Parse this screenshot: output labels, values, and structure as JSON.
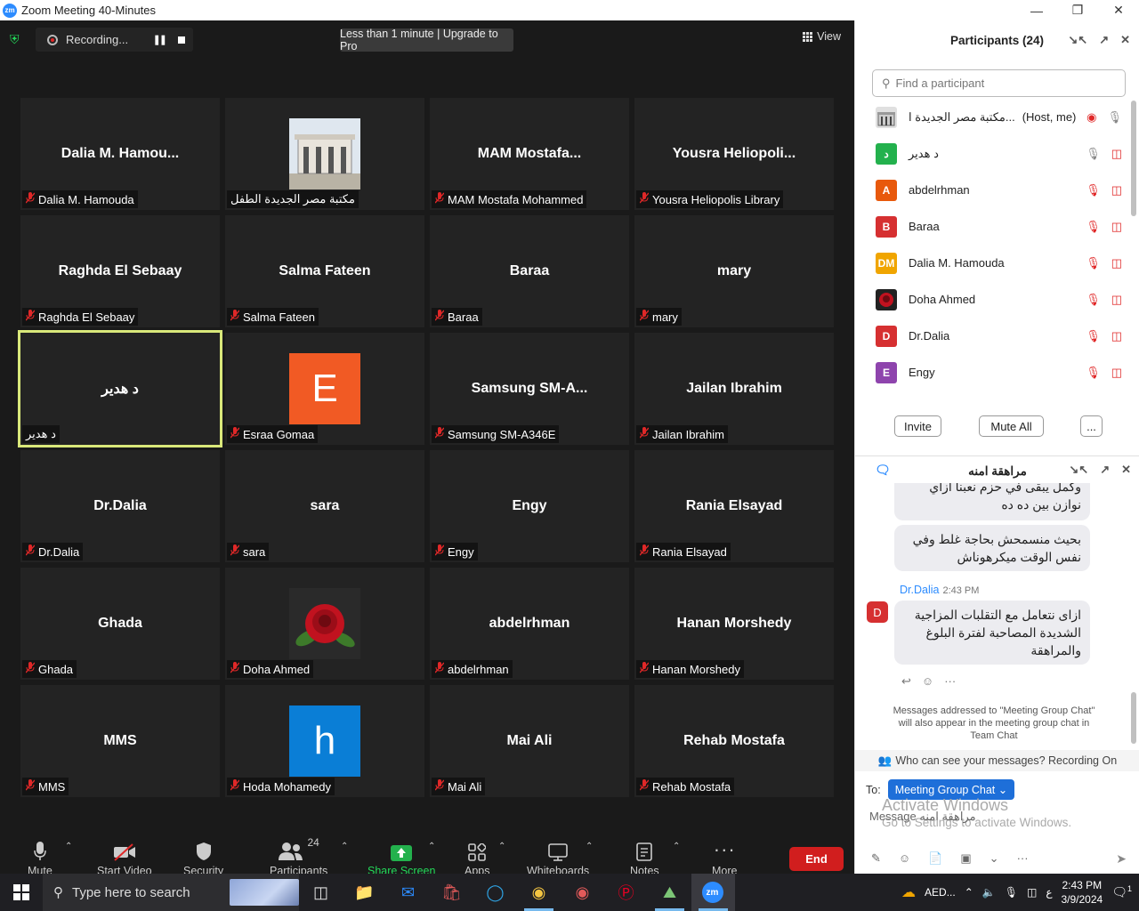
{
  "window": {
    "title": "Zoom Meeting 40-Minutes",
    "logo": "zm"
  },
  "topbar": {
    "recording_label": "Recording...",
    "timer_text": "Less than 1 minute | Upgrade to Pro",
    "view_label": "View"
  },
  "tiles": [
    {
      "display": "Dalia  M.  Hamou...",
      "label": "Dalia M. Hamouda",
      "muted": true,
      "avatar": null
    },
    {
      "display": "",
      "label": "مكتبة مصر الجديدة الطفل",
      "muted": false,
      "avatar": {
        "kind": "photo-building"
      }
    },
    {
      "display": "MAM  Mostafa...",
      "label": "MAM Mostafa Mohammed",
      "muted": true,
      "avatar": null
    },
    {
      "display": "Yousra  Heliopoli...",
      "label": "Yousra Heliopolis Library",
      "muted": true,
      "avatar": null
    },
    {
      "display": "Raghda El Sebaay",
      "label": "Raghda El Sebaay",
      "muted": true,
      "avatar": null
    },
    {
      "display": "Salma Fateen",
      "label": "Salma Fateen",
      "muted": true,
      "avatar": null
    },
    {
      "display": "Baraa",
      "label": "Baraa",
      "muted": true,
      "avatar": null
    },
    {
      "display": "mary",
      "label": "mary",
      "muted": true,
      "avatar": null
    },
    {
      "display": "د هدير",
      "label": "د هدير",
      "muted": false,
      "avatar": null,
      "active": true
    },
    {
      "display": "",
      "label": "Esraa Gomaa",
      "muted": true,
      "avatar": {
        "kind": "letter",
        "letter": "E",
        "color": "#f15a24"
      }
    },
    {
      "display": "Samsung  SM-A...",
      "label": "Samsung SM-A346E",
      "muted": true,
      "avatar": null
    },
    {
      "display": "Jailan Ibrahim",
      "label": "Jailan Ibrahim",
      "muted": true,
      "avatar": null
    },
    {
      "display": "Dr.Dalia",
      "label": "Dr.Dalia",
      "muted": true,
      "avatar": null
    },
    {
      "display": "sara",
      "label": "sara",
      "muted": true,
      "avatar": null
    },
    {
      "display": "Engy",
      "label": "Engy",
      "muted": true,
      "avatar": null
    },
    {
      "display": "Rania Elsayad",
      "label": "Rania Elsayad",
      "muted": true,
      "avatar": null
    },
    {
      "display": "Ghada",
      "label": "Ghada",
      "muted": true,
      "avatar": null
    },
    {
      "display": "",
      "label": "Doha Ahmed",
      "muted": true,
      "avatar": {
        "kind": "photo-rose"
      }
    },
    {
      "display": "abdelrhman",
      "label": "abdelrhman",
      "muted": true,
      "avatar": null
    },
    {
      "display": "Hanan Morshedy",
      "label": "Hanan Morshedy",
      "muted": true,
      "avatar": null
    },
    {
      "display": "MMS",
      "label": "MMS",
      "muted": true,
      "avatar": null
    },
    {
      "display": "",
      "label": "Hoda Mohamedy",
      "muted": true,
      "avatar": {
        "kind": "letter",
        "letter": "h",
        "color": "#0a7ed6"
      }
    },
    {
      "display": "Mai Ali",
      "label": "Mai Ali",
      "muted": true,
      "avatar": null
    },
    {
      "display": "Rehab Mostafa",
      "label": "Rehab Mostafa",
      "muted": true,
      "avatar": null
    }
  ],
  "toolbar": {
    "mute": "Mute",
    "start_video": "Start Video",
    "security": "Security",
    "participants": "Participants",
    "participants_count": "24",
    "share_screen": "Share Screen",
    "apps": "Apps",
    "whiteboards": "Whiteboards",
    "notes": "Notes",
    "more": "More",
    "end": "End"
  },
  "participants_panel": {
    "title": "Participants (24)",
    "search_placeholder": "Find a participant",
    "list": [
      {
        "name": "مكتبة مصر الجديدة ا...",
        "tag": "(Host, me)",
        "avatar": "building",
        "color": "#888"
      },
      {
        "name": "د هدير",
        "tag": "",
        "avatar": "د",
        "color": "#23b14d"
      },
      {
        "name": "abdelrhman",
        "tag": "",
        "avatar": "A",
        "color": "#e8590c"
      },
      {
        "name": "Baraa",
        "tag": "",
        "avatar": "B",
        "color": "#d63031"
      },
      {
        "name": "Dalia M. Hamouda",
        "tag": "",
        "avatar": "DM",
        "color": "#f0a500"
      },
      {
        "name": "Doha Ahmed",
        "tag": "",
        "avatar": "rose",
        "color": "#8b0000"
      },
      {
        "name": "Dr.Dalia",
        "tag": "",
        "avatar": "D",
        "color": "#d63031"
      },
      {
        "name": "Engy",
        "tag": "",
        "avatar": "E",
        "color": "#8e44ad"
      }
    ],
    "invite": "Invite",
    "mute_all": "Mute All",
    "more": "..."
  },
  "chat": {
    "title": "مراهقة امنه",
    "msg_top": "وكمل يبقى في حزم نعبنا ازاي نوازن بين ده ده",
    "msg_mid": "بحيث منسمحش بحاجة غلط وفي نفس الوقت ميكرهوناش",
    "sender": "Dr.Dalia",
    "sender_initial": "D",
    "time": "2:43 PM",
    "msg_last": "ازاى نتعامل مع التقلبات المزاجية الشديدة المصاحبة لفترة البلوغ والمراهقة",
    "note": "Messages addressed to \"Meeting Group Chat\" will also appear in the meeting group chat in Team Chat",
    "who_can_see": "Who can see your messages? Recording On",
    "to_label": "To:",
    "to_value": "Meeting Group Chat",
    "message_placeholder": "Message مراهقة امنه",
    "activate_title": "Activate Windows",
    "activate_sub": "Go to Settings to activate Windows."
  },
  "taskbar": {
    "search_placeholder": "Type here to search",
    "lang": "AED...",
    "ime": "ع",
    "time": "2:43 PM",
    "date": "3/9/2024",
    "notif_count": "1"
  }
}
